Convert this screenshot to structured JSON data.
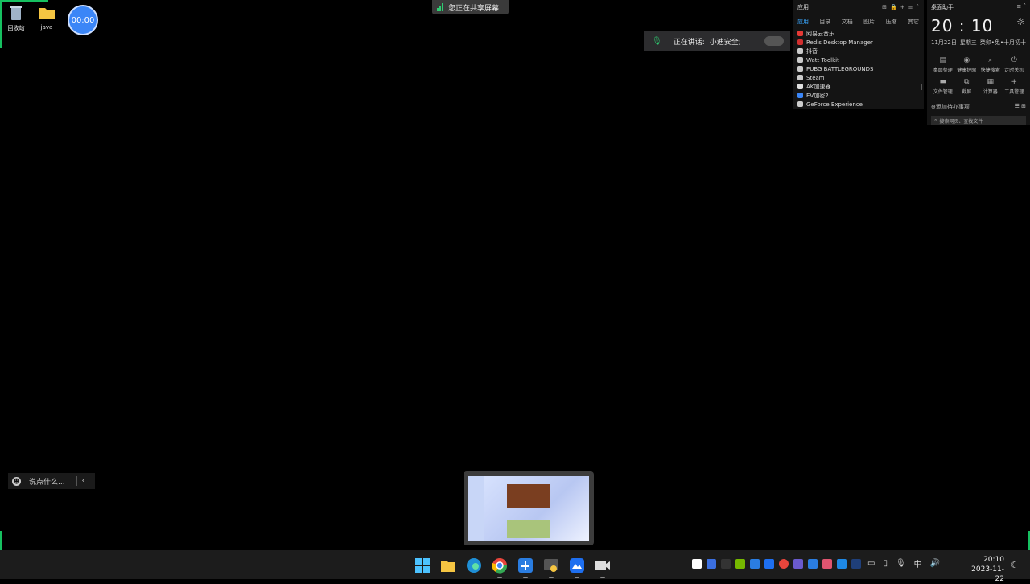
{
  "desktop": {
    "icons": [
      {
        "label": "回收站",
        "icon": "recycle-bin-icon"
      },
      {
        "label": "java",
        "icon": "folder-icon"
      }
    ],
    "timer": "00:00"
  },
  "share_banner": {
    "label": "您正在共享屏幕"
  },
  "speaking": {
    "prefix": "正在讲话:",
    "name": "小迪安全;"
  },
  "apps_panel": {
    "title": "应用",
    "tabs": [
      {
        "label": "应用",
        "active": true
      },
      {
        "label": "目录"
      },
      {
        "label": "文档"
      },
      {
        "label": "图片"
      },
      {
        "label": "压缩"
      },
      {
        "label": "其它"
      }
    ],
    "items": [
      {
        "label": "网易云音乐",
        "color": "#e53935"
      },
      {
        "label": "Redis Desktop Manager",
        "color": "#d32f2f"
      },
      {
        "label": "抖音",
        "color": "#cccccc"
      },
      {
        "label": "Watt Toolkit",
        "color": "#cccccc"
      },
      {
        "label": "PUBG BATTLEGROUNDS",
        "color": "#cccccc"
      },
      {
        "label": "Steam",
        "color": "#cccccc"
      },
      {
        "label": "AK加速器",
        "color": "#e0e0e0"
      },
      {
        "label": "EV加密2",
        "color": "#3b86f7"
      },
      {
        "label": "GeForce Experience",
        "color": "#cccccc"
      }
    ]
  },
  "assistant": {
    "title": "桌面助手",
    "time": "20 : 10",
    "date": "11月22日",
    "weekday": "星期三",
    "lunar": "癸卯•兔•十月初十",
    "tools": [
      {
        "label": "桌面整理",
        "icon": "desktop-organize-icon"
      },
      {
        "label": "健康护眼",
        "icon": "eye-icon"
      },
      {
        "label": "快捷搜索",
        "icon": "search-icon"
      },
      {
        "label": "定时关机",
        "icon": "power-icon"
      },
      {
        "label": "文件管理",
        "icon": "folder-icon"
      },
      {
        "label": "截屏",
        "icon": "crop-icon"
      },
      {
        "label": "计算器",
        "icon": "calculator-icon"
      },
      {
        "label": "工具管理",
        "icon": "plus-icon"
      }
    ],
    "todo": "添加待办事项",
    "search_placeholder": "搜索网页、查找文件"
  },
  "chat": {
    "placeholder": "说点什么..."
  },
  "taskbar": {
    "time": "20:10",
    "date": "2023-11-22",
    "ime": "中",
    "accent": "#3b86f7"
  }
}
